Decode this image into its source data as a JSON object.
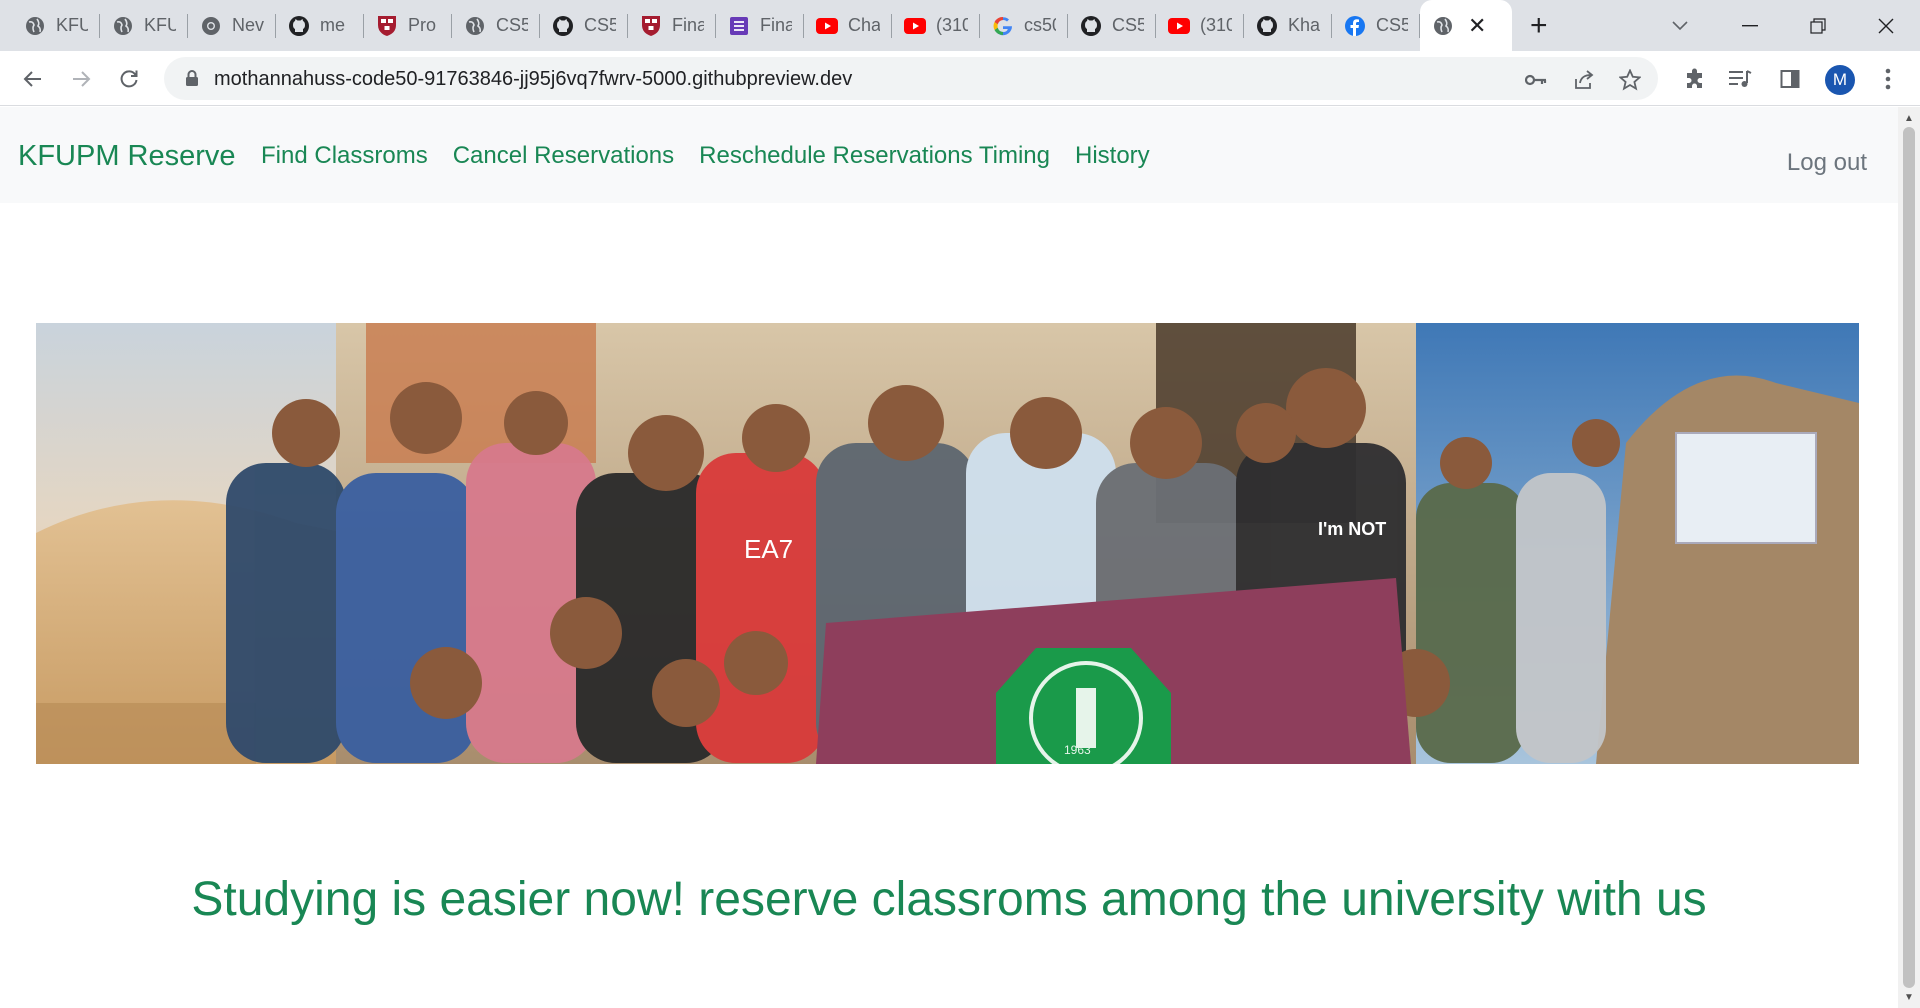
{
  "browser": {
    "tabs": [
      {
        "title": "KFU",
        "icon": "globe-icon"
      },
      {
        "title": "KFU",
        "icon": "globe-icon"
      },
      {
        "title": "Nev",
        "icon": "chrome-icon"
      },
      {
        "title": "me",
        "icon": "github-icon"
      },
      {
        "title": "Pro",
        "icon": "harvard-shield-icon"
      },
      {
        "title": "CS5",
        "icon": "globe-icon"
      },
      {
        "title": "CS5",
        "icon": "github-icon"
      },
      {
        "title": "Fina",
        "icon": "harvard-shield-icon"
      },
      {
        "title": "Fina",
        "icon": "form-icon"
      },
      {
        "title": "Cha",
        "icon": "youtube-icon"
      },
      {
        "title": "(310",
        "icon": "youtube-icon"
      },
      {
        "title": "cs50",
        "icon": "google-icon"
      },
      {
        "title": "CS5",
        "icon": "github-icon"
      },
      {
        "title": "(310",
        "icon": "youtube-icon"
      },
      {
        "title": "Kha",
        "icon": "github-icon"
      },
      {
        "title": "CS5",
        "icon": "facebook-icon"
      }
    ],
    "active_tab": {
      "icon": "globe-icon",
      "close": "✕"
    },
    "new_tab": "+",
    "url": "mothannahuss-code50-91763846-jj95j6vq7fwrv-5000.githubpreview.dev",
    "profile_initial": "M"
  },
  "nav": {
    "brand": "KFUPM Reserve",
    "links": [
      "Find Classroms",
      "Cancel Reservations",
      "Reschedule Reservations Timing",
      "History"
    ],
    "logout": "Log out"
  },
  "hero": {
    "description": "banner photo",
    "banner_text": [
      "EA7",
      "I'm NOT",
      "1963"
    ]
  },
  "tagline": "Studying is easier now! reserve classroms among the university with us",
  "colors": {
    "accent_green": "#198754",
    "muted_gray": "#6c757d",
    "navbar_bg": "#f8f9fa",
    "banner_maroon": "#8e3e5c"
  }
}
